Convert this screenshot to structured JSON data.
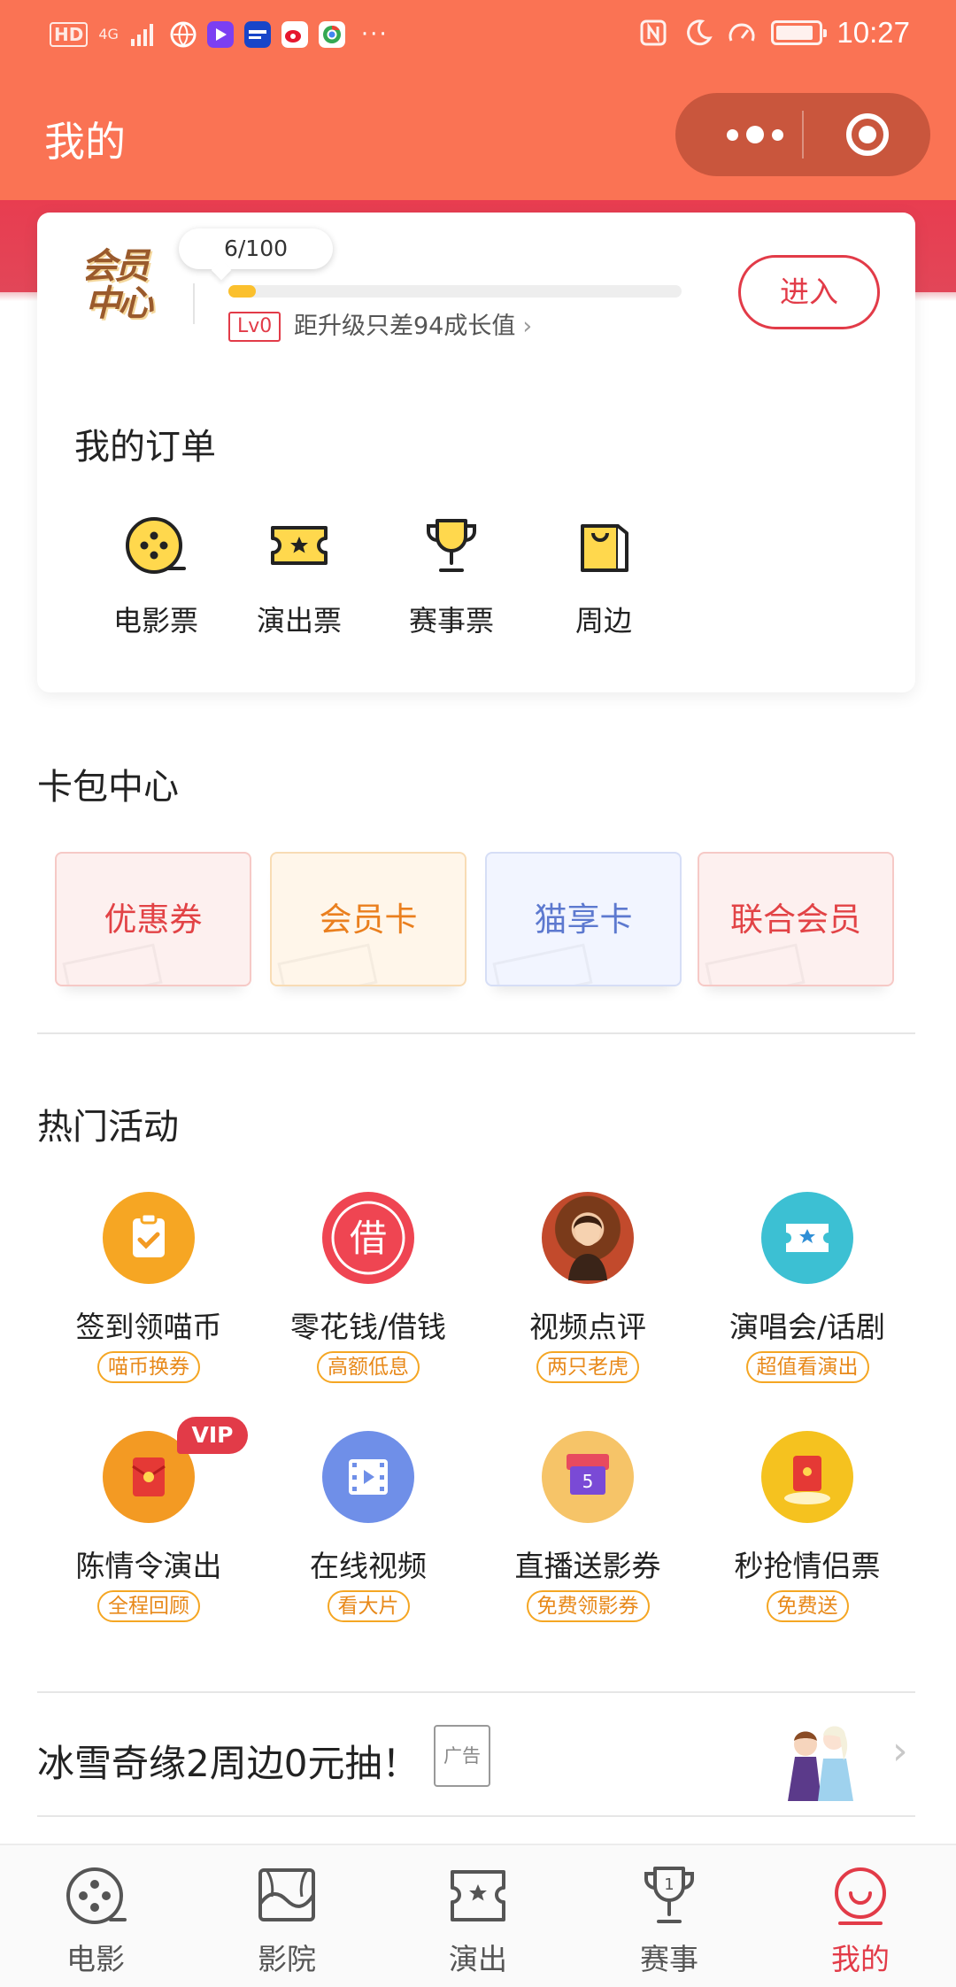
{
  "status_bar": {
    "left_hd": "HD",
    "left_net": "4G",
    "time": "10:27",
    "more": "···"
  },
  "header": {
    "title": "我的",
    "capsule": {
      "more_icon": "more-dots-icon",
      "close_icon": "target-close-icon"
    }
  },
  "member": {
    "logo_text_1": "会员",
    "logo_text_2": "中心",
    "growth_label": "6/100",
    "growth_progress": 0.06,
    "level": "Lv0",
    "level_tip": "距升级只差94成长值",
    "level_tip_chevron": "›",
    "enter_button": "进入"
  },
  "orders": {
    "title": "我的订单",
    "items": [
      {
        "label": "电影票",
        "icon": "film-reel-icon"
      },
      {
        "label": "演出票",
        "icon": "show-ticket-icon"
      },
      {
        "label": "赛事票",
        "icon": "trophy-icon"
      },
      {
        "label": "周边",
        "icon": "shopping-bag-icon"
      }
    ]
  },
  "card_pack": {
    "title": "卡包中心",
    "items": [
      {
        "label": "优惠券",
        "color": "#e24346",
        "bg": "#fdf0ef",
        "border": "#f6c9c6"
      },
      {
        "label": "会员卡",
        "color": "#ea7f1e",
        "bg": "#fff6ea",
        "border": "#f8dcb5"
      },
      {
        "label": "猫享卡",
        "color": "#5d79cf",
        "bg": "#f2f5ff",
        "border": "#d6def6"
      },
      {
        "label": "联合会员",
        "color": "#e24346",
        "bg": "#fdf0ef",
        "border": "#f6c9c6"
      }
    ]
  },
  "activities": {
    "title": "热门活动",
    "items": [
      {
        "name": "签到领喵币",
        "tag": "喵币换券",
        "icon": "checkin-clipboard-icon",
        "color": "#f6a623"
      },
      {
        "name": "零花钱/借钱",
        "tag": "高额低息",
        "icon": "borrow-jie-icon",
        "color": "#ef4552",
        "glyph": "借"
      },
      {
        "name": "视频点评",
        "tag": "两只老虎",
        "icon": "video-avatar-icon",
        "color": "#b65a34"
      },
      {
        "name": "演唱会/话剧",
        "tag": "超值看演出",
        "icon": "concert-ticket-icon",
        "color": "#3cc0d3"
      },
      {
        "name": "陈情令演出",
        "tag": "全程回顾",
        "icon": "red-envelope-icon",
        "color": "#f39a23",
        "badge": "VIP"
      },
      {
        "name": "在线视频",
        "tag": "看大片",
        "icon": "film-strip-icon",
        "color": "#6f8fe8"
      },
      {
        "name": "直播送影券",
        "tag": "免费领影券",
        "icon": "live-coupon-icon",
        "color": "#f6c468"
      },
      {
        "name": "秒抢情侣票",
        "tag": "免费送",
        "icon": "gift-envelope-icon",
        "color": "#f5c21f"
      }
    ]
  },
  "ad": {
    "title": "冰雪奇缘2周边0元抽！",
    "tag": "广告",
    "chevron": "›"
  },
  "tabbar": {
    "items": [
      {
        "label": "电影",
        "icon": "film-reel-tab-icon",
        "active": false
      },
      {
        "label": "影院",
        "icon": "cinema-screen-icon",
        "active": false
      },
      {
        "label": "演出",
        "icon": "show-ticket-tab-icon",
        "active": false
      },
      {
        "label": "赛事",
        "icon": "trophy-tab-icon",
        "active": false
      },
      {
        "label": "我的",
        "icon": "profile-smile-icon",
        "active": true
      }
    ]
  }
}
